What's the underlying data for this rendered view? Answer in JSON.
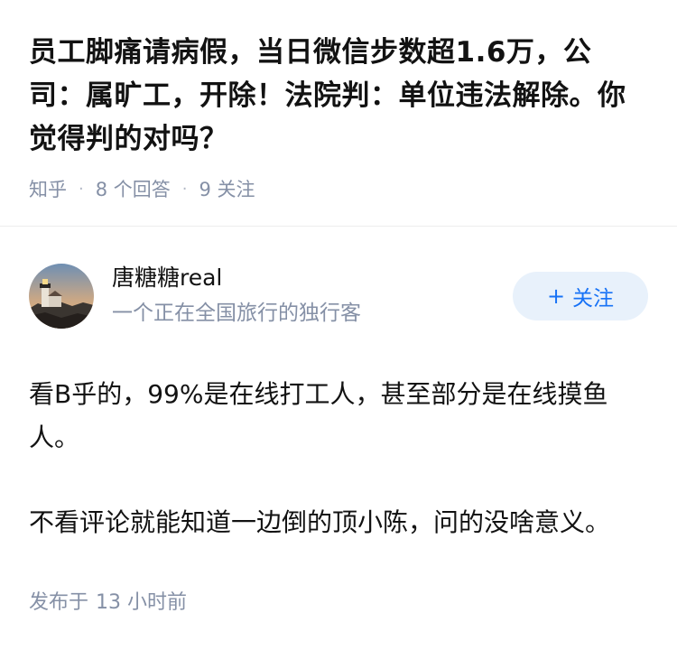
{
  "question": {
    "title": "员工脚痛请病假，当日微信步数超1.6万，公司：属旷工，开除！法院判：单位违法解除。你觉得判的对吗？",
    "source": "知乎",
    "answer_count": "8 个回答",
    "follow_count": "9 关注"
  },
  "answer": {
    "author": {
      "name": "唐糖糖real",
      "bio": "一个正在全国旅行的独行客",
      "avatar_icon": "lighthouse-photo-avatar"
    },
    "follow_button": {
      "icon": "+",
      "label": "关注"
    },
    "paragraphs": [
      "看B乎的，99%是在线打工人，甚至部分是在线摸鱼人。",
      "不看评论就能知道一边倒的顶小陈，问的没啥意义。"
    ],
    "published_label": "发布于",
    "published_time": "13 小时前"
  },
  "colors": {
    "accent": "#1772f6",
    "follow_bg": "#e8f1fb",
    "meta_gray": "#8590a6",
    "text": "#121212"
  }
}
